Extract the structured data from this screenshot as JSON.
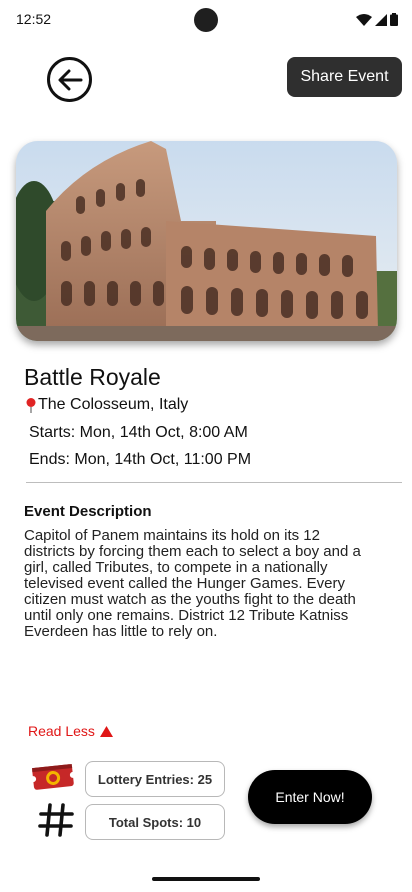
{
  "status_bar": {
    "time": "12:52",
    "icons": [
      "wifi-icon",
      "signal-icon",
      "battery-icon"
    ]
  },
  "header": {
    "back_icon": "arrow-left-circle-icon",
    "share_label": "Share Event"
  },
  "hero_image": {
    "subject": "Colosseum photograph"
  },
  "event": {
    "title": "Battle Royale",
    "location": "The Colosseum, Italy",
    "location_icon": "map-pin-icon",
    "starts": "Starts: Mon, 14th Oct, 8:00 AM",
    "ends": "Ends: Mon, 14th Oct, 11:00 PM"
  },
  "description": {
    "heading": "Event Description",
    "body": "Capitol of Panem maintains its hold on its 12 districts by forcing them each to select a boy and a girl, called Tributes, to compete in a nationally televised event called the Hunger Games. Every citizen must watch as the youths fight to the death until only one remains. District 12 Tribute Katniss Everdeen has little to rely on.",
    "toggle_label": "Read Less",
    "toggle_icon": "triangle-up-icon"
  },
  "stats": {
    "lottery_entries": "Lottery Entries: 25",
    "total_spots": "Total Spots: 10"
  },
  "actions": {
    "enter_label": "Enter  Now!"
  },
  "colors": {
    "accent_red": "#e01616",
    "share_bg": "#2f2f2f",
    "enter_bg": "#000000"
  }
}
